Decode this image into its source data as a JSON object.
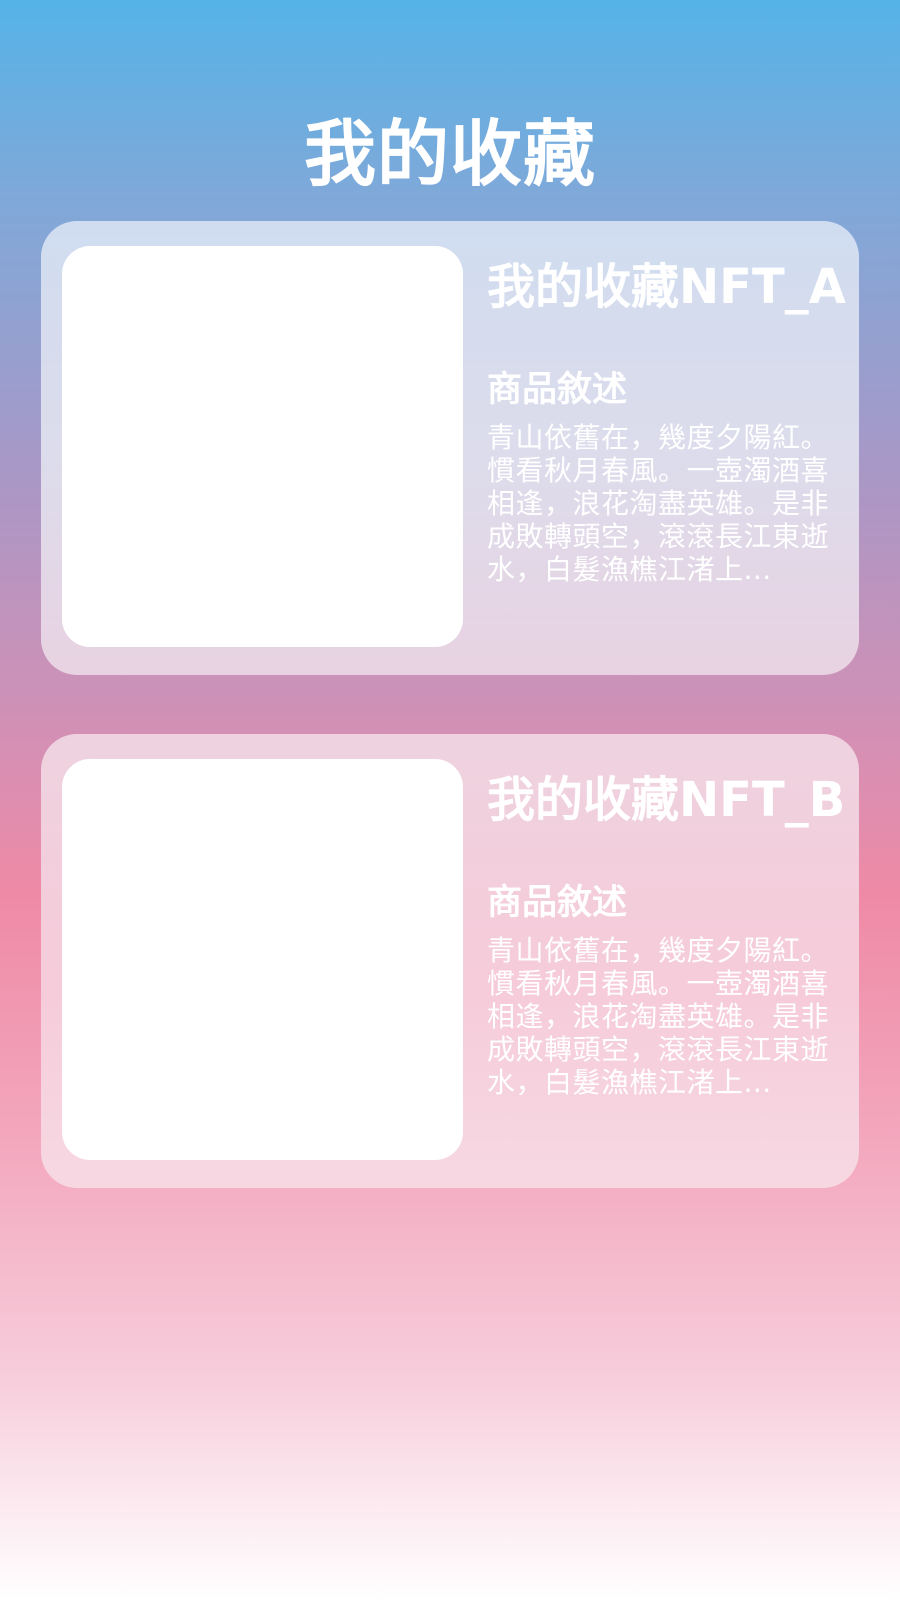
{
  "page": {
    "title": "我的收藏"
  },
  "items": [
    {
      "name": "我的收藏NFT_A",
      "description_label": "商品敘述",
      "description": "青山依舊在，幾度夕陽紅。慣看秋月春風。一壺濁酒喜相逢，浪花淘盡英雄。是非成敗轉頭空，滾滾長江東逝水，白髮漁樵江渚上..."
    },
    {
      "name": "我的收藏NFT_B",
      "description_label": "商品敘述",
      "description": "青山依舊在，幾度夕陽紅。慣看秋月春風。一壺濁酒喜相逢，浪花淘盡英雄。是非成敗轉頭空，滾滾長江東逝水，白髮漁樵江渚上..."
    }
  ],
  "colors": {
    "gradient_top": "#55b3e8",
    "gradient_middle": "#ef8aa6",
    "gradient_bottom": "#ffffff",
    "text": "#ffffff",
    "thumbnail": "#ffffff"
  }
}
